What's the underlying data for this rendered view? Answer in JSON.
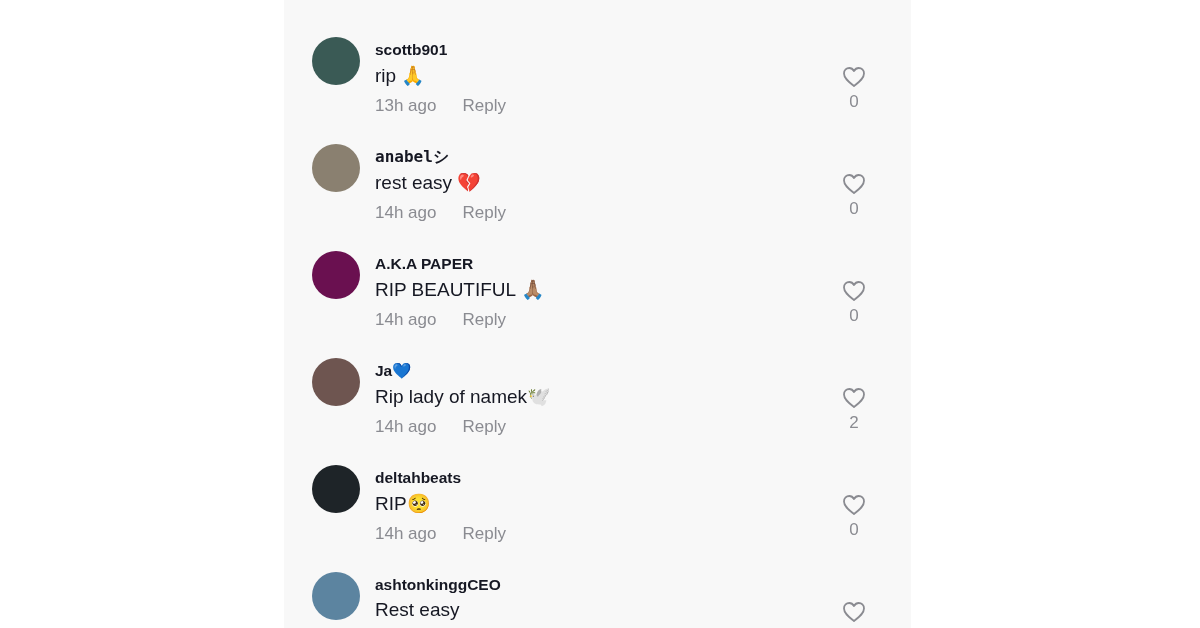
{
  "comments": [
    {
      "kind": "plain",
      "username": "scottb901",
      "text": "rip 🙏",
      "time": "13h ago",
      "reply": "Reply",
      "likes": "0"
    },
    {
      "kind": "serif",
      "username": "anabelシ",
      "text": "rest easy 💔",
      "time": "14h ago",
      "reply": "Reply",
      "likes": "0"
    },
    {
      "kind": "plain",
      "username": "A.K.A PAPER",
      "text": "RIP BEAUTIFUL 🙏🏽",
      "time": "14h ago",
      "reply": "Reply",
      "likes": "0"
    },
    {
      "kind": "plain",
      "username": "Ja💙",
      "text": "Rip lady of namek🕊️",
      "time": "14h ago",
      "reply": "Reply",
      "likes": "2"
    },
    {
      "kind": "plain",
      "username": "deltahbeats",
      "text": "RIP🥺",
      "time": "14h ago",
      "reply": "Reply",
      "likes": "0"
    },
    {
      "kind": "plain",
      "username": "ashtonkinggCEO",
      "text": "Rest easy"
    }
  ]
}
